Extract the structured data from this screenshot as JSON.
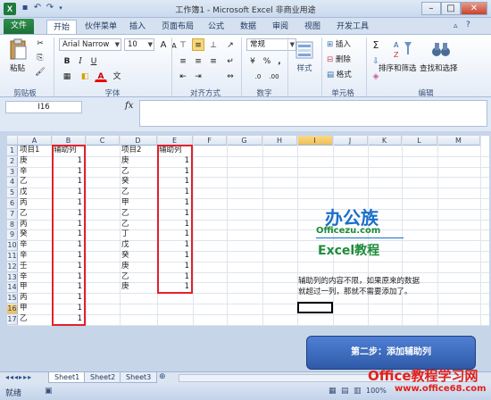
{
  "window": {
    "title": "工作簿1 - Microsoft Excel 非商业用途",
    "app_icon": "X"
  },
  "tabs": [
    "文件",
    "开始",
    "伙伴菜单",
    "插入",
    "页面布局",
    "公式",
    "数据",
    "审阅",
    "视图",
    "开发工具"
  ],
  "ribbon": {
    "clipboard": {
      "paste": "粘贴",
      "label": "剪贴板"
    },
    "font": {
      "name": "Arial Narrow",
      "size": "10",
      "bold": "B",
      "italic": "I",
      "underline": "U",
      "font_color_letter": "A",
      "grow": "A",
      "shrink": "A",
      "label": "字体"
    },
    "alignment": {
      "label": "对齐方式"
    },
    "number": {
      "format": "常规",
      "currency": "¥",
      "percent": "%",
      "comma": ",",
      "label": "数字"
    },
    "styles": {
      "label": "样式"
    },
    "cells": {
      "insert": "插入",
      "delete": "删除",
      "format": "格式",
      "label": "单元格"
    },
    "editing": {
      "sum": "Σ",
      "sort_filter": "排序和筛选",
      "find_select": "查找和选择",
      "label": "编辑"
    }
  },
  "formula_bar": {
    "name_box": "I16",
    "fx": "fx",
    "formula": ""
  },
  "grid": {
    "columns": [
      "A",
      "B",
      "C",
      "D",
      "E",
      "F",
      "G",
      "H",
      "I",
      "J",
      "K",
      "L",
      "M"
    ],
    "rows": [
      "1",
      "2",
      "3",
      "4",
      "5",
      "6",
      "7",
      "8",
      "9",
      "10",
      "11",
      "12",
      "13",
      "14",
      "15",
      "16",
      "17"
    ],
    "selected_column": "I",
    "selected_row": "16",
    "col_a": [
      "项目1",
      "庚",
      "辛",
      "乙",
      "戊",
      "丙",
      "乙",
      "丙",
      "癸",
      "辛",
      "辛",
      "壬",
      "辛",
      "甲",
      "丙",
      "甲",
      "乙"
    ],
    "col_b": [
      "辅助列",
      "1",
      "1",
      "1",
      "1",
      "1",
      "1",
      "1",
      "1",
      "1",
      "1",
      "1",
      "1",
      "1",
      "1",
      "1",
      "1"
    ],
    "col_d": [
      "项目2",
      "庚",
      "乙",
      "癸",
      "乙",
      "甲",
      "乙",
      "乙",
      "丁",
      "戊",
      "癸",
      "庚",
      "乙",
      "庚"
    ],
    "col_e": [
      "辅助列",
      "1",
      "1",
      "1",
      "1",
      "1",
      "1",
      "1",
      "1",
      "1",
      "1",
      "1",
      "1",
      "1"
    ],
    "note_line1": "辅助列的内容不限，如果原来的数据",
    "note_line2": "就超过一列，那就不需要添加了。"
  },
  "logo": {
    "text_cn": "办公族",
    "text_en": "Officezu.com",
    "text_excel": "Excel教程"
  },
  "callout": {
    "text": "第二步：添加辅助列"
  },
  "sheets": [
    "Sheet1",
    "Sheet2",
    "Sheet3"
  ],
  "status": {
    "ready": "就绪",
    "zoom": "100%"
  },
  "watermark": {
    "line1": "Office教程学习网",
    "line2": "www.office68.com"
  },
  "colors": {
    "excel_green": "#1d7a3b",
    "red_highlight": "#e0222d",
    "callout_blue": "#3d6bc4",
    "logo_blue": "#1a6fc9",
    "logo_green": "#1f8c3a",
    "watermark_red": "#e3201b"
  }
}
